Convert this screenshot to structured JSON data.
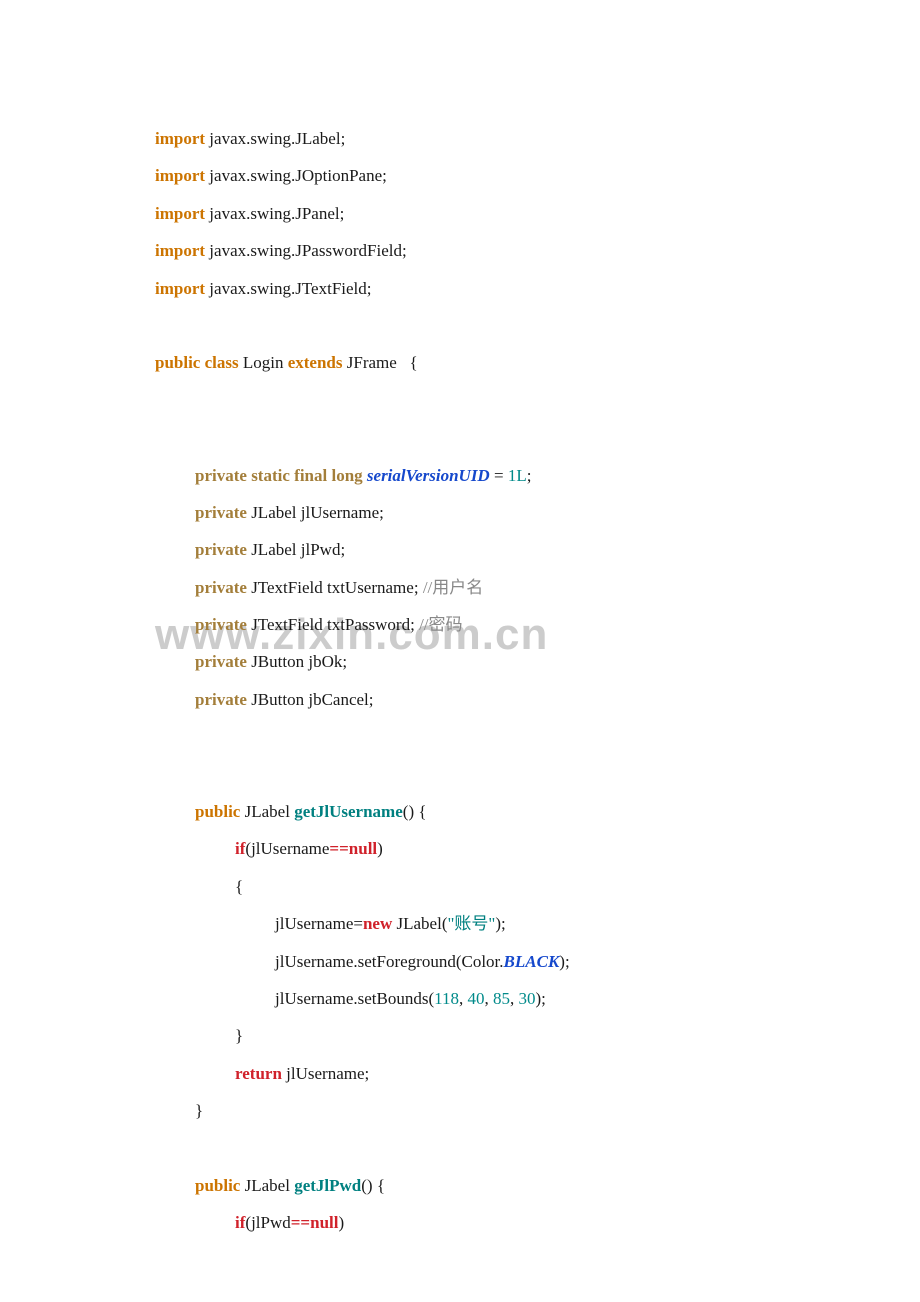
{
  "watermark": "www.zixin.com.cn",
  "kw": {
    "import": "import",
    "public": "public",
    "class": "class",
    "extends": "extends",
    "private": "private",
    "static": "static",
    "final": "final",
    "long": "long",
    "if": "if",
    "null": "null",
    "return": "return",
    "new": "new"
  },
  "types": {
    "JLabel": "JLabel",
    "JOptionPane": "JOptionPane",
    "JPanel": "JPanel",
    "JPasswordField": "JPasswordField",
    "JTextField": "JTextField",
    "JFrame": "JFrame",
    "JButton": "JButton",
    "Color": "Color"
  },
  "pkg": {
    "swing": "javax.swing"
  },
  "cls": "Login",
  "fields": {
    "serialVersionUID": "serialVersionUID",
    "jlUsername": "jlUsername",
    "jlPwd": "jlPwd",
    "txtUsername": "txtUsername",
    "txtPassword": "txtPassword",
    "jbOk": "jbOk",
    "jbCancel": "jbCancel"
  },
  "methods": {
    "getJlUsername": "getJlUsername",
    "getJlPwd": "getJlPwd",
    "setForeground": "setForeground",
    "setBounds": "setBounds"
  },
  "consts": {
    "BLACK": "BLACK"
  },
  "strings": {
    "zhanghao": "\"账号\""
  },
  "nums": {
    "one": "1L",
    "n118": "118",
    "n40": "40",
    "n85": "85",
    "n30": "30"
  },
  "comments": {
    "username": "//用户名",
    "password": "//密码"
  },
  "sym": {
    "eq": " = ",
    "eqeq": "==",
    "assign": "=",
    "semicolon": ";",
    "dot": ".",
    "lbrace": "{",
    "rbrace": "}",
    "lparen": "(",
    "rparen": ")",
    "comma": ", ",
    "sp": " "
  }
}
